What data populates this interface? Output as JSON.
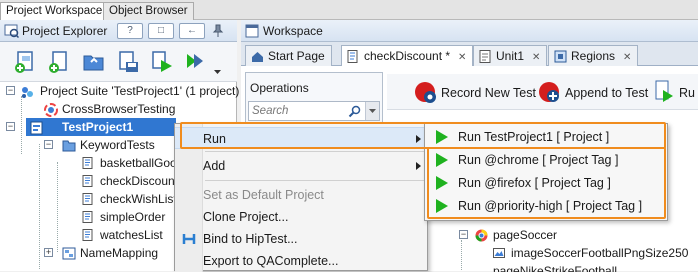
{
  "top_tabs": [
    "Project Workspace",
    "Object Browser"
  ],
  "explorer": {
    "title": "Project Explorer",
    "header_buttons": [
      "?",
      "□",
      "←"
    ]
  },
  "tree": [
    {
      "label": "Project Suite 'TestProject1' (1 project)"
    },
    {
      "label": "CrossBrowserTesting"
    },
    {
      "label": "TestProject1"
    },
    {
      "label": "KeywordTests"
    },
    {
      "label": "basketballGoods"
    },
    {
      "label": "checkDiscount"
    },
    {
      "label": "checkWishList"
    },
    {
      "label": "simpleOrder"
    },
    {
      "label": "watchesList"
    },
    {
      "label": "NameMapping"
    }
  ],
  "workspace": {
    "title": "Workspace",
    "tabs": [
      {
        "label": "Start Page"
      },
      {
        "label": "checkDiscount *"
      },
      {
        "label": "Unit1"
      },
      {
        "label": "Regions"
      }
    ]
  },
  "operations": {
    "title": "Operations",
    "search_placeholder": "Search"
  },
  "record_bar": {
    "record_label": "Record New Test",
    "append_label": "Append to Test",
    "run_label": "Ru"
  },
  "bg_tree": [
    {
      "label": "pageSoccer"
    },
    {
      "label": "imageSoccerFootballPngSize250"
    },
    {
      "label": "pageNikeStrikeFootball"
    }
  ],
  "context_menu": {
    "items": [
      {
        "label": "Run"
      },
      {
        "label": "Add"
      },
      {
        "label": "Set as Default Project"
      },
      {
        "label": "Clone Project..."
      },
      {
        "label": "Bind to HipTest..."
      },
      {
        "label": "Export to QAComplete..."
      }
    ]
  },
  "run_submenu": {
    "items": [
      {
        "label": "Run TestProject1  [ Project ]"
      },
      {
        "label": "Run @chrome  [ Project Tag ]"
      },
      {
        "label": "Run @firefox  [ Project Tag ]"
      },
      {
        "label": "Run @priority-high  [ Project Tag ]"
      }
    ]
  },
  "colors": {
    "selection": "#3077d1",
    "highlight_box": "#f08c1e",
    "run_icon": "#1fb21f"
  }
}
